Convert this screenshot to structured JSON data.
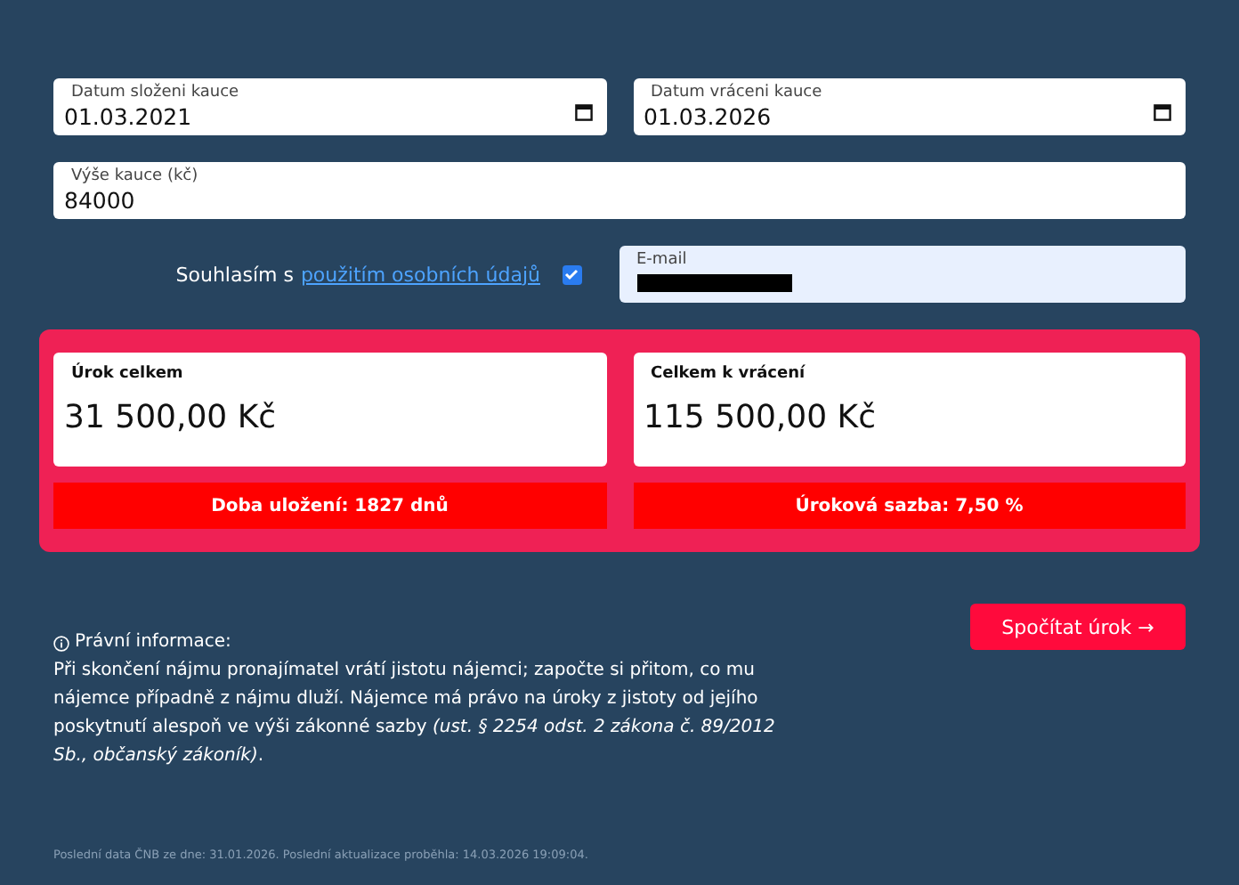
{
  "date_fields": [
    {
      "label": "Datum složeni kauce",
      "value": "01.03.2021"
    },
    {
      "label": "Datum vráceni kauce",
      "value": "01.03.2026"
    }
  ],
  "amount_field": {
    "label": "Výše kauce (kč)",
    "value": "84000"
  },
  "consent": {
    "text": "Souhlasím s",
    "link": "použitím osobních údajů",
    "checked": true
  },
  "email_field": {
    "label": "E-mail",
    "redacted": true
  },
  "results": [
    {
      "title": "Úrok celkem",
      "value": "31 500,00 Kč",
      "footer": "Doba uložení: 1827 dnů"
    },
    {
      "title": "Celkem k vrácení",
      "value": "115 500,00 Kč",
      "footer": "Úroková sazba: 7,50 %"
    }
  ],
  "legal": {
    "heading": "Právní informace:",
    "text": "Při skončení nájmu pronajímatel vrátí jistotu nájemci; započte si přitom, co mu nájemce případně z nájmu dluží. Nájemce má právo na úroky z jistoty od jejího poskytnutí alespoň ve výši zákonné sazby *(ust. § 2254 odst. 2 zákona č. 89/2012 Sb., občanský zákoník)*."
  },
  "calc_button": "Spočítat úrok →",
  "footer": "Poslední data ČNB ze dne: 31.01.2026. Poslední aktualizace proběhla: 14.03.2026 19:09:04."
}
